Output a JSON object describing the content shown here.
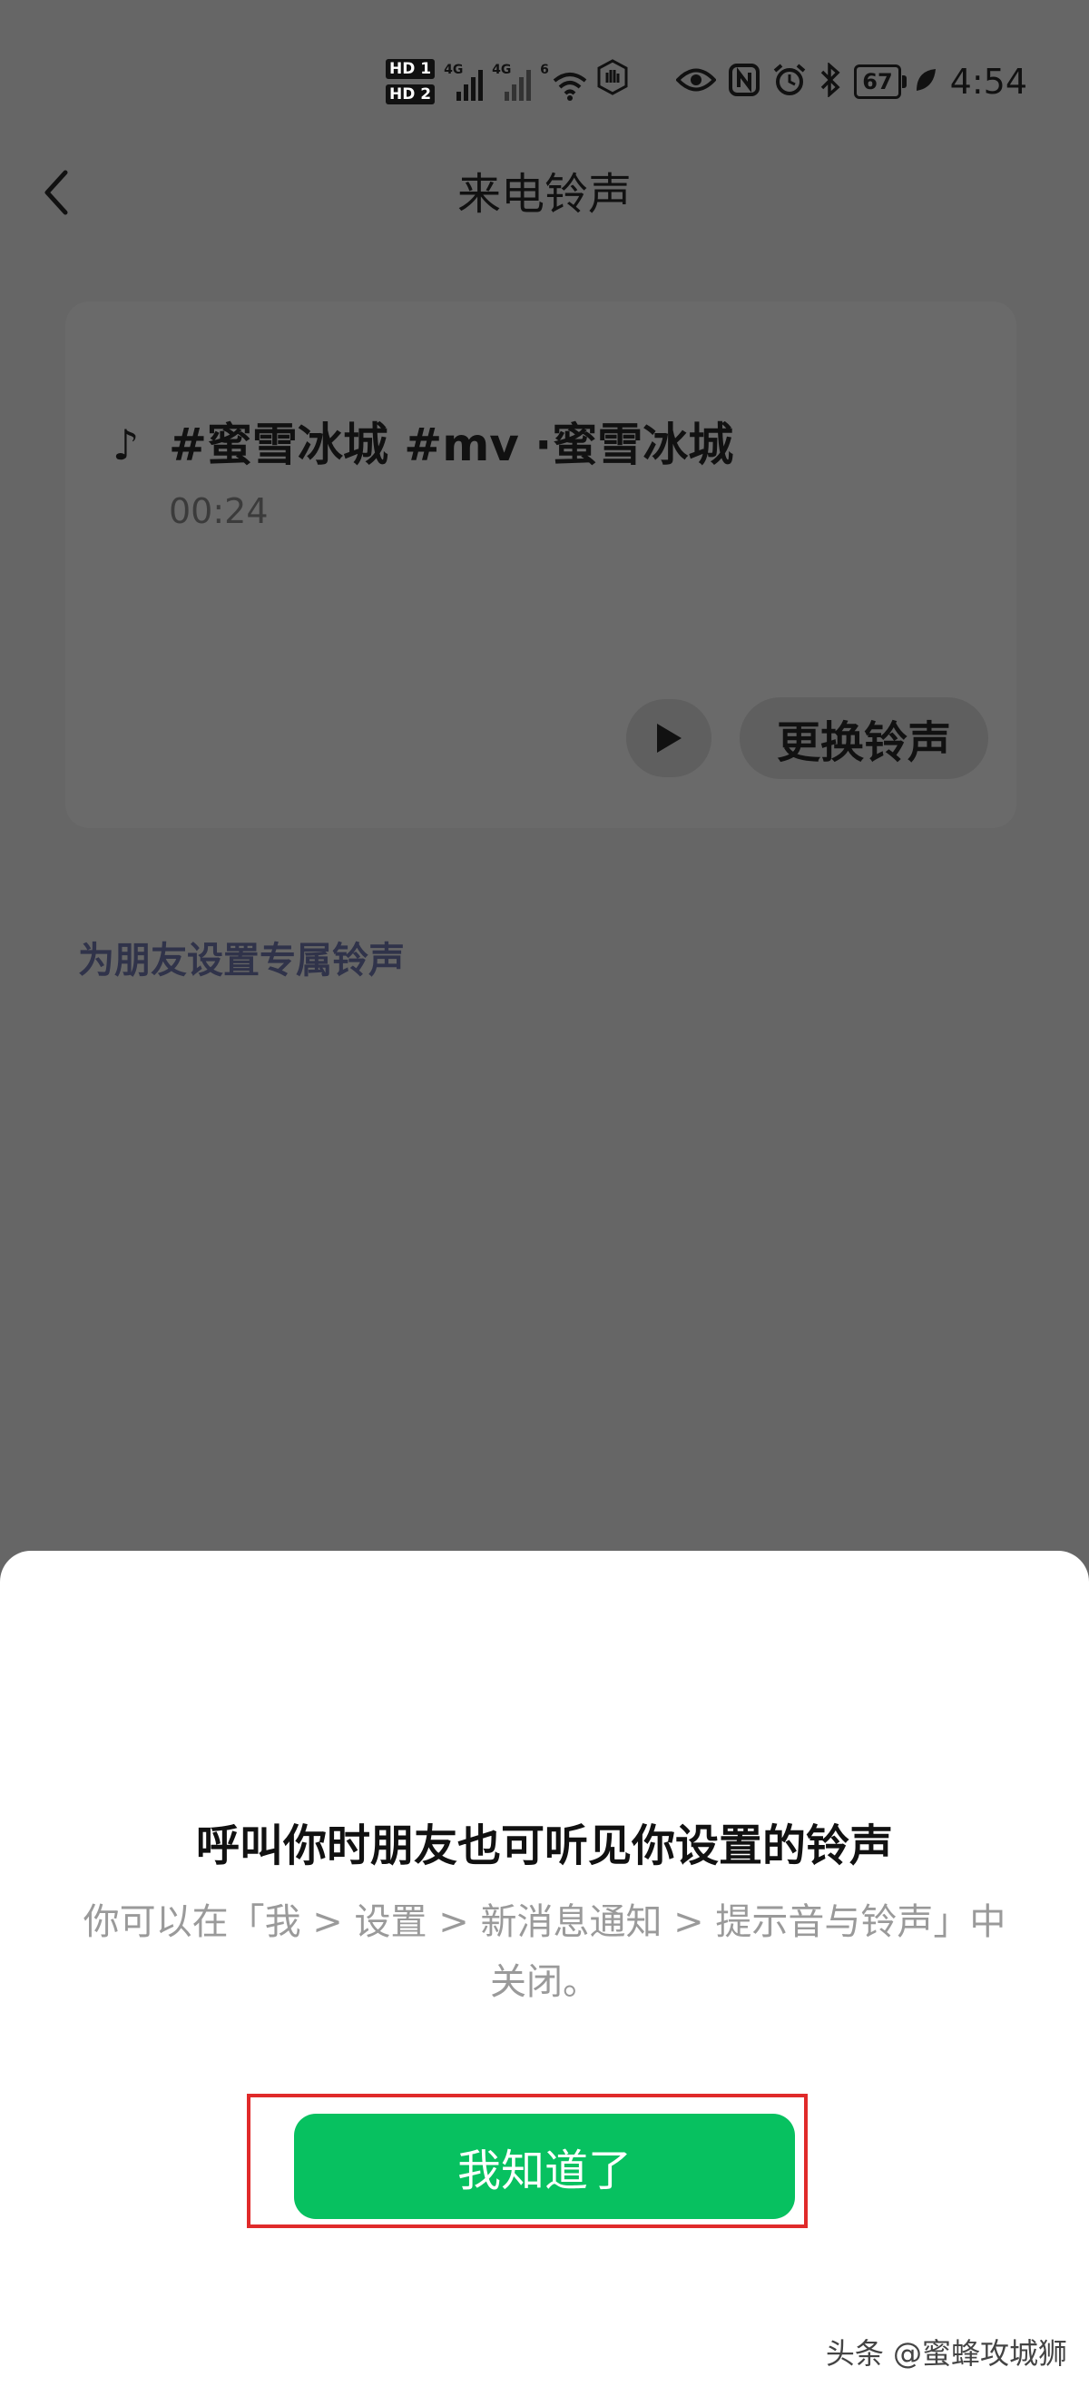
{
  "status_bar": {
    "hd_1": "HD 1",
    "hd_2": "HD 2",
    "signal_1": "4G",
    "signal_2": "4G",
    "wifi": "6",
    "battery": "67",
    "time": "4:54"
  },
  "nav": {
    "title": "来电铃声"
  },
  "ringtone": {
    "name": "#蜜雪冰城 #mv ·蜜雪冰城",
    "duration": "00:24",
    "change_label": "更换铃声"
  },
  "friend_link": "为朋友设置专属铃声",
  "sheet": {
    "title": "呼叫你时朋友也可听见你设置的铃声",
    "description": "你可以在「我 > 设置 > 新消息通知 > 提示音与铃声」中关闭。",
    "confirm_label": "我知道了"
  },
  "watermark": "头条 @蜜蜂攻城狮",
  "colors": {
    "overlay": "#666666",
    "primary_green": "#07c160",
    "highlight_red": "#e02a2a",
    "link_text": "#30334a"
  }
}
